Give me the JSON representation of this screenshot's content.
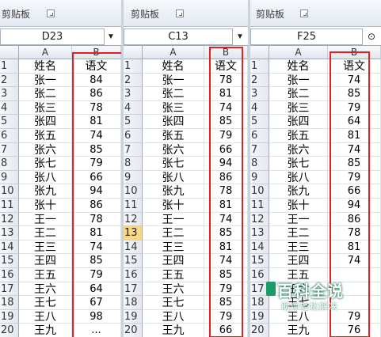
{
  "panels": [
    {
      "ribbon_label": "剪贴板",
      "name_box": "D23",
      "columns": [
        "A",
        "B"
      ],
      "rows": [
        {
          "n": "1",
          "name": "姓名",
          "score": "语文"
        },
        {
          "n": "2",
          "name": "张一",
          "score": "84"
        },
        {
          "n": "3",
          "name": "张二",
          "score": "86"
        },
        {
          "n": "4",
          "name": "张三",
          "score": "78"
        },
        {
          "n": "5",
          "name": "张四",
          "score": "81"
        },
        {
          "n": "6",
          "name": "张五",
          "score": "74"
        },
        {
          "n": "7",
          "name": "张六",
          "score": "85"
        },
        {
          "n": "8",
          "name": "张七",
          "score": "79"
        },
        {
          "n": "9",
          "name": "张八",
          "score": "66"
        },
        {
          "n": "10",
          "name": "张九",
          "score": "94"
        },
        {
          "n": "11",
          "name": "张十",
          "score": "86"
        },
        {
          "n": "12",
          "name": "王一",
          "score": "78"
        },
        {
          "n": "13",
          "name": "王二",
          "score": "81"
        },
        {
          "n": "14",
          "name": "王三",
          "score": "74"
        },
        {
          "n": "15",
          "name": "王四",
          "score": "85"
        },
        {
          "n": "16",
          "name": "王五",
          "score": "79"
        },
        {
          "n": "17",
          "name": "王六",
          "score": "64"
        },
        {
          "n": "18",
          "name": "王七",
          "score": "67"
        },
        {
          "n": "19",
          "name": "王八",
          "score": "98"
        },
        {
          "n": "20",
          "name": "王九",
          "score": "..."
        }
      ]
    },
    {
      "ribbon_label": "剪贴板",
      "name_box": "C13",
      "columns": [
        "A",
        "B"
      ],
      "selected_row": "13",
      "rows": [
        {
          "n": "1",
          "name": "姓名",
          "score": "语文"
        },
        {
          "n": "2",
          "name": "张一",
          "score": "78"
        },
        {
          "n": "3",
          "name": "张二",
          "score": "81"
        },
        {
          "n": "4",
          "name": "张三",
          "score": "74"
        },
        {
          "n": "5",
          "name": "张四",
          "score": "85"
        },
        {
          "n": "6",
          "name": "张五",
          "score": "79"
        },
        {
          "n": "7",
          "name": "张六",
          "score": "66"
        },
        {
          "n": "8",
          "name": "张七",
          "score": "94"
        },
        {
          "n": "9",
          "name": "张八",
          "score": "86"
        },
        {
          "n": "10",
          "name": "张九",
          "score": "78"
        },
        {
          "n": "11",
          "name": "张十",
          "score": "81"
        },
        {
          "n": "12",
          "name": "王一",
          "score": "74"
        },
        {
          "n": "13",
          "name": "王二",
          "score": "85"
        },
        {
          "n": "14",
          "name": "王三",
          "score": "81"
        },
        {
          "n": "15",
          "name": "王四",
          "score": "74"
        },
        {
          "n": "16",
          "name": "王五",
          "score": "85"
        },
        {
          "n": "17",
          "name": "王六",
          "score": "79"
        },
        {
          "n": "18",
          "name": "王七",
          "score": "85"
        },
        {
          "n": "19",
          "name": "王八",
          "score": "79"
        },
        {
          "n": "20",
          "name": "王九",
          "score": "66"
        }
      ]
    },
    {
      "ribbon_label": "剪贴板",
      "name_box": "F25",
      "columns": [
        "A",
        "B"
      ],
      "rows": [
        {
          "n": "1",
          "name": "姓名",
          "score": "语文"
        },
        {
          "n": "2",
          "name": "张一",
          "score": "74"
        },
        {
          "n": "3",
          "name": "张二",
          "score": "85"
        },
        {
          "n": "4",
          "name": "张三",
          "score": "79"
        },
        {
          "n": "5",
          "name": "张四",
          "score": "64"
        },
        {
          "n": "6",
          "name": "张五",
          "score": "81"
        },
        {
          "n": "7",
          "name": "张六",
          "score": "74"
        },
        {
          "n": "8",
          "name": "张七",
          "score": "85"
        },
        {
          "n": "9",
          "name": "张八",
          "score": "79"
        },
        {
          "n": "10",
          "name": "张九",
          "score": "66"
        },
        {
          "n": "11",
          "name": "张十",
          "score": "94"
        },
        {
          "n": "12",
          "name": "王一",
          "score": "86"
        },
        {
          "n": "13",
          "name": "王二",
          "score": "78"
        },
        {
          "n": "14",
          "name": "王三",
          "score": "81"
        },
        {
          "n": "15",
          "name": "王四",
          "score": "74"
        },
        {
          "n": "16",
          "name": "王五",
          "score": ""
        },
        {
          "n": "17",
          "name": "王六",
          "score": ""
        },
        {
          "n": "18",
          "name": "王七",
          "score": ""
        },
        {
          "n": "19",
          "name": "王八",
          "score": "79"
        },
        {
          "n": "20",
          "name": "王九",
          "score": "76"
        }
      ]
    }
  ],
  "watermark": {
    "title": "百科全说",
    "subtitle": "助你轻松解决"
  },
  "colors": {
    "highlight_border": "#e62020",
    "selected_row_header": "#f9d78a"
  }
}
